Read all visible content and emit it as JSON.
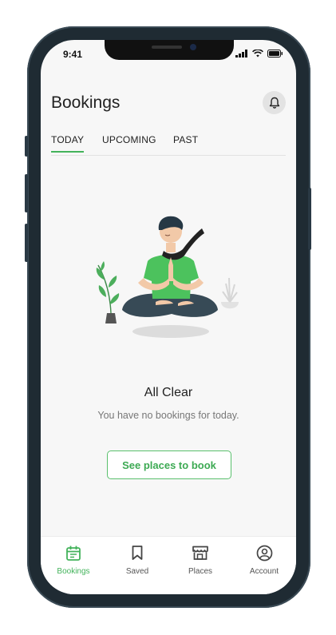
{
  "status_bar": {
    "time": "9:41"
  },
  "header": {
    "title": "Bookings"
  },
  "tabs": [
    {
      "label": "TODAY",
      "active": true
    },
    {
      "label": "UPCOMING",
      "active": false
    },
    {
      "label": "PAST",
      "active": false
    }
  ],
  "empty_state": {
    "title": "All Clear",
    "subtitle": "You have no bookings for today.",
    "cta_label": "See places to book"
  },
  "bottom_nav": [
    {
      "label": "Bookings",
      "icon": "calendar-icon",
      "active": true
    },
    {
      "label": "Saved",
      "icon": "bookmark-icon",
      "active": false
    },
    {
      "label": "Places",
      "icon": "storefront-icon",
      "active": false
    },
    {
      "label": "Account",
      "icon": "user-circle-icon",
      "active": false
    }
  ],
  "colors": {
    "accent": "#43b35b",
    "background": "#f7f7f7",
    "frame": "#1f2b33"
  }
}
